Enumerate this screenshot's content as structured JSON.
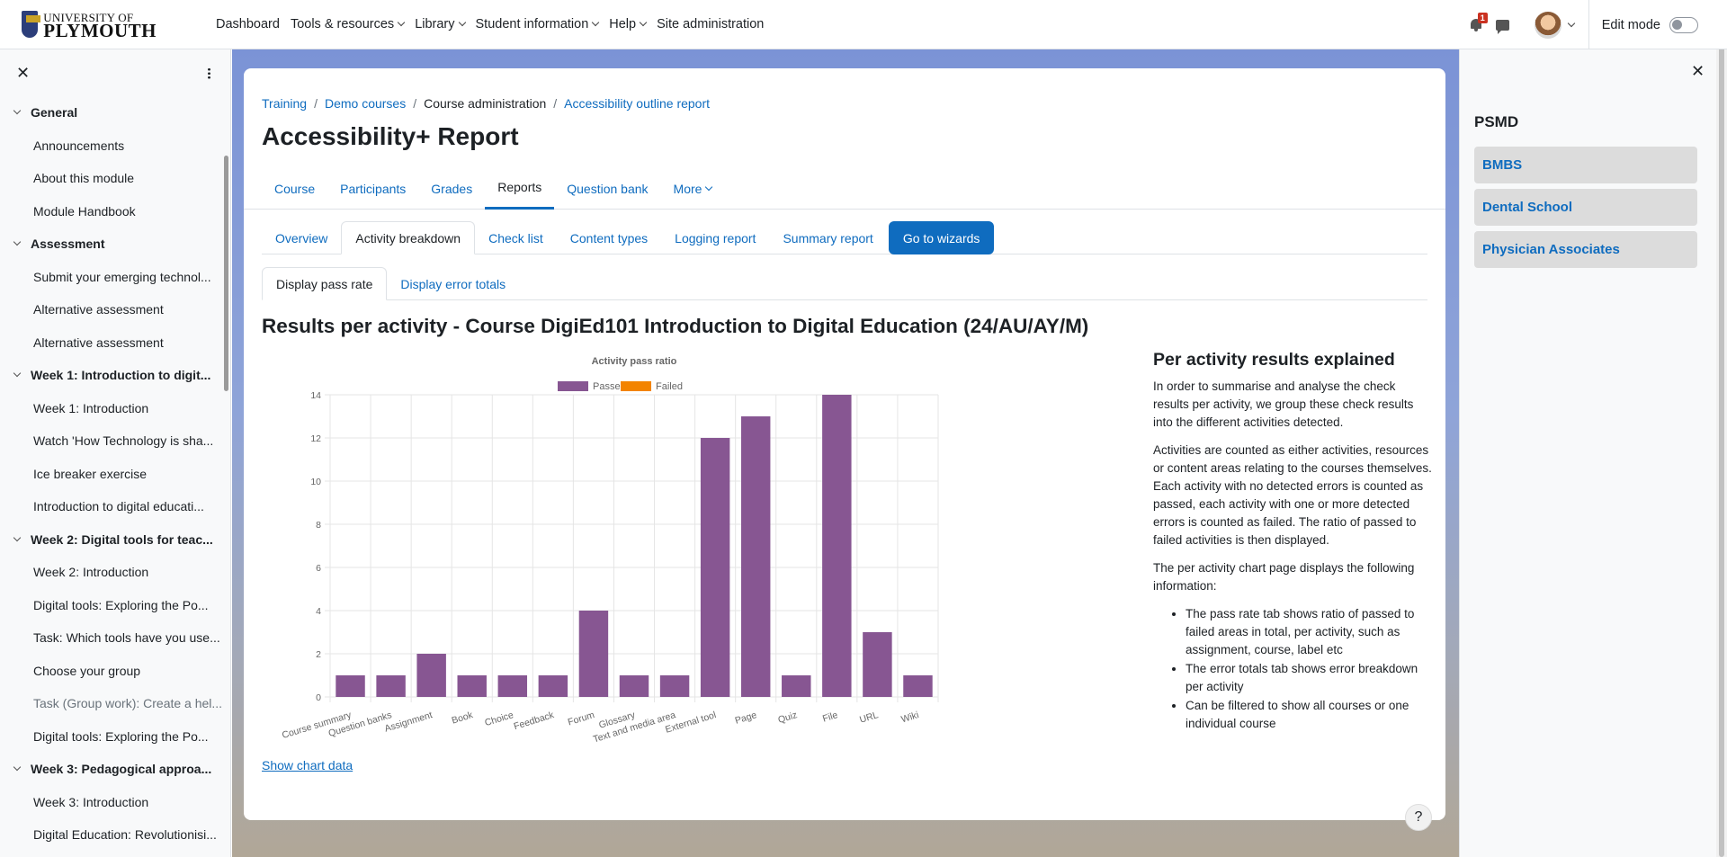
{
  "navbar": {
    "logo_line1": "UNIVERSITY OF",
    "logo_line2": "PLYMOUTH",
    "items": [
      "Dashboard",
      "Tools & resources",
      "Library",
      "Student information",
      "Help",
      "Site administration"
    ],
    "notification_count": "1",
    "edit_mode_label": "Edit mode"
  },
  "course_index": {
    "items": [
      {
        "label": "General",
        "type": "section"
      },
      {
        "label": "Announcements",
        "type": "activity"
      },
      {
        "label": "About this module",
        "type": "activity"
      },
      {
        "label": "Module Handbook",
        "type": "activity"
      },
      {
        "label": "Assessment",
        "type": "section"
      },
      {
        "label": "Submit your emerging technol...",
        "type": "activity"
      },
      {
        "label": "Alternative assessment",
        "type": "activity"
      },
      {
        "label": "Alternative assessment",
        "type": "activity"
      },
      {
        "label": "Week 1: Introduction to digit...",
        "type": "section"
      },
      {
        "label": "Week 1: Introduction",
        "type": "activity"
      },
      {
        "label": "Watch 'How Technology is sha...",
        "type": "activity"
      },
      {
        "label": "Ice breaker exercise",
        "type": "activity"
      },
      {
        "label": "Introduction to digital educati...",
        "type": "activity"
      },
      {
        "label": "Week 2: Digital tools for teac...",
        "type": "section"
      },
      {
        "label": "Week 2: Introduction",
        "type": "activity"
      },
      {
        "label": "Digital tools: Exploring  the Po...",
        "type": "activity"
      },
      {
        "label": "Task: Which tools have you use...",
        "type": "activity"
      },
      {
        "label": "Choose your group",
        "type": "activity"
      },
      {
        "label": "Task (Group work): Create a hel...",
        "type": "activity dim"
      },
      {
        "label": "Digital tools: Exploring  the Po...",
        "type": "activity"
      },
      {
        "label": "Week 3: Pedagogical approa...",
        "type": "section"
      },
      {
        "label": "Week 3: Introduction",
        "type": "activity"
      },
      {
        "label": "Digital Education: Revolutionisi...",
        "type": "activity"
      }
    ]
  },
  "breadcrumb": [
    "Training",
    "Demo courses",
    "Course administration",
    "Accessibility outline report"
  ],
  "page_title": "Accessibility+ Report",
  "secondary_nav": [
    "Course",
    "Participants",
    "Grades",
    "Reports",
    "Question bank",
    "More"
  ],
  "secondary_nav_active": "Reports",
  "report_tabs": [
    "Overview",
    "Activity breakdown",
    "Check list",
    "Content types",
    "Logging report",
    "Summary report"
  ],
  "report_tabs_active": "Activity breakdown",
  "wizard_button": "Go to wizards",
  "sub_tabs": [
    "Display pass rate",
    "Display error totals"
  ],
  "sub_tabs_active": "Display pass rate",
  "results_heading": "Results per activity - Course DigiEd101 Introduction to Digital Education (24/AU/AY/M)",
  "chart_data": {
    "type": "bar",
    "title": "Activity pass ratio",
    "categories": [
      "Course summary",
      "Question banks",
      "Assignment",
      "Book",
      "Choice",
      "Feedback",
      "Forum",
      "Glossary",
      "Text and media area",
      "External tool",
      "Page",
      "Quiz",
      "File",
      "URL",
      "Wiki"
    ],
    "series": [
      {
        "name": "Passed",
        "color": "#875692",
        "values": [
          1,
          1,
          2,
          1,
          1,
          1,
          4,
          1,
          1,
          12,
          13,
          1,
          14,
          3,
          1
        ]
      },
      {
        "name": "Failed",
        "color": "#f38400",
        "values": [
          0,
          0,
          0,
          0,
          0,
          0,
          0,
          0,
          0,
          0,
          0,
          0,
          0,
          0,
          0
        ]
      }
    ],
    "ylim": [
      0,
      14
    ],
    "yticks": [
      0,
      2,
      4,
      6,
      8,
      10,
      12,
      14
    ],
    "legend": "top",
    "grid": true
  },
  "show_chart_data": "Show chart data",
  "explanation": {
    "heading": "Per activity results explained",
    "p1": "In order to summarise and analyse the check results per activity, we group these check results into the different activities detected.",
    "p2": "Activities are counted as either activities, resources or content areas relating to the courses themselves. Each activity with no detected errors is counted as passed, each activity with one or more detected errors is counted as failed. The ratio of passed to failed activities is then displayed.",
    "p3": "The per activity chart page displays the following information:",
    "bullets": [
      "The pass rate tab shows ratio of passed to failed areas in total, per activity, such as assignment, course, label etc",
      "The error totals tab shows error breakdown per activity",
      "Can be filtered to show all courses or one individual course"
    ]
  },
  "help_label": "?",
  "right_block": {
    "title": "PSMD",
    "buttons": [
      "BMBS",
      "Dental School",
      "Physician Associates"
    ]
  }
}
